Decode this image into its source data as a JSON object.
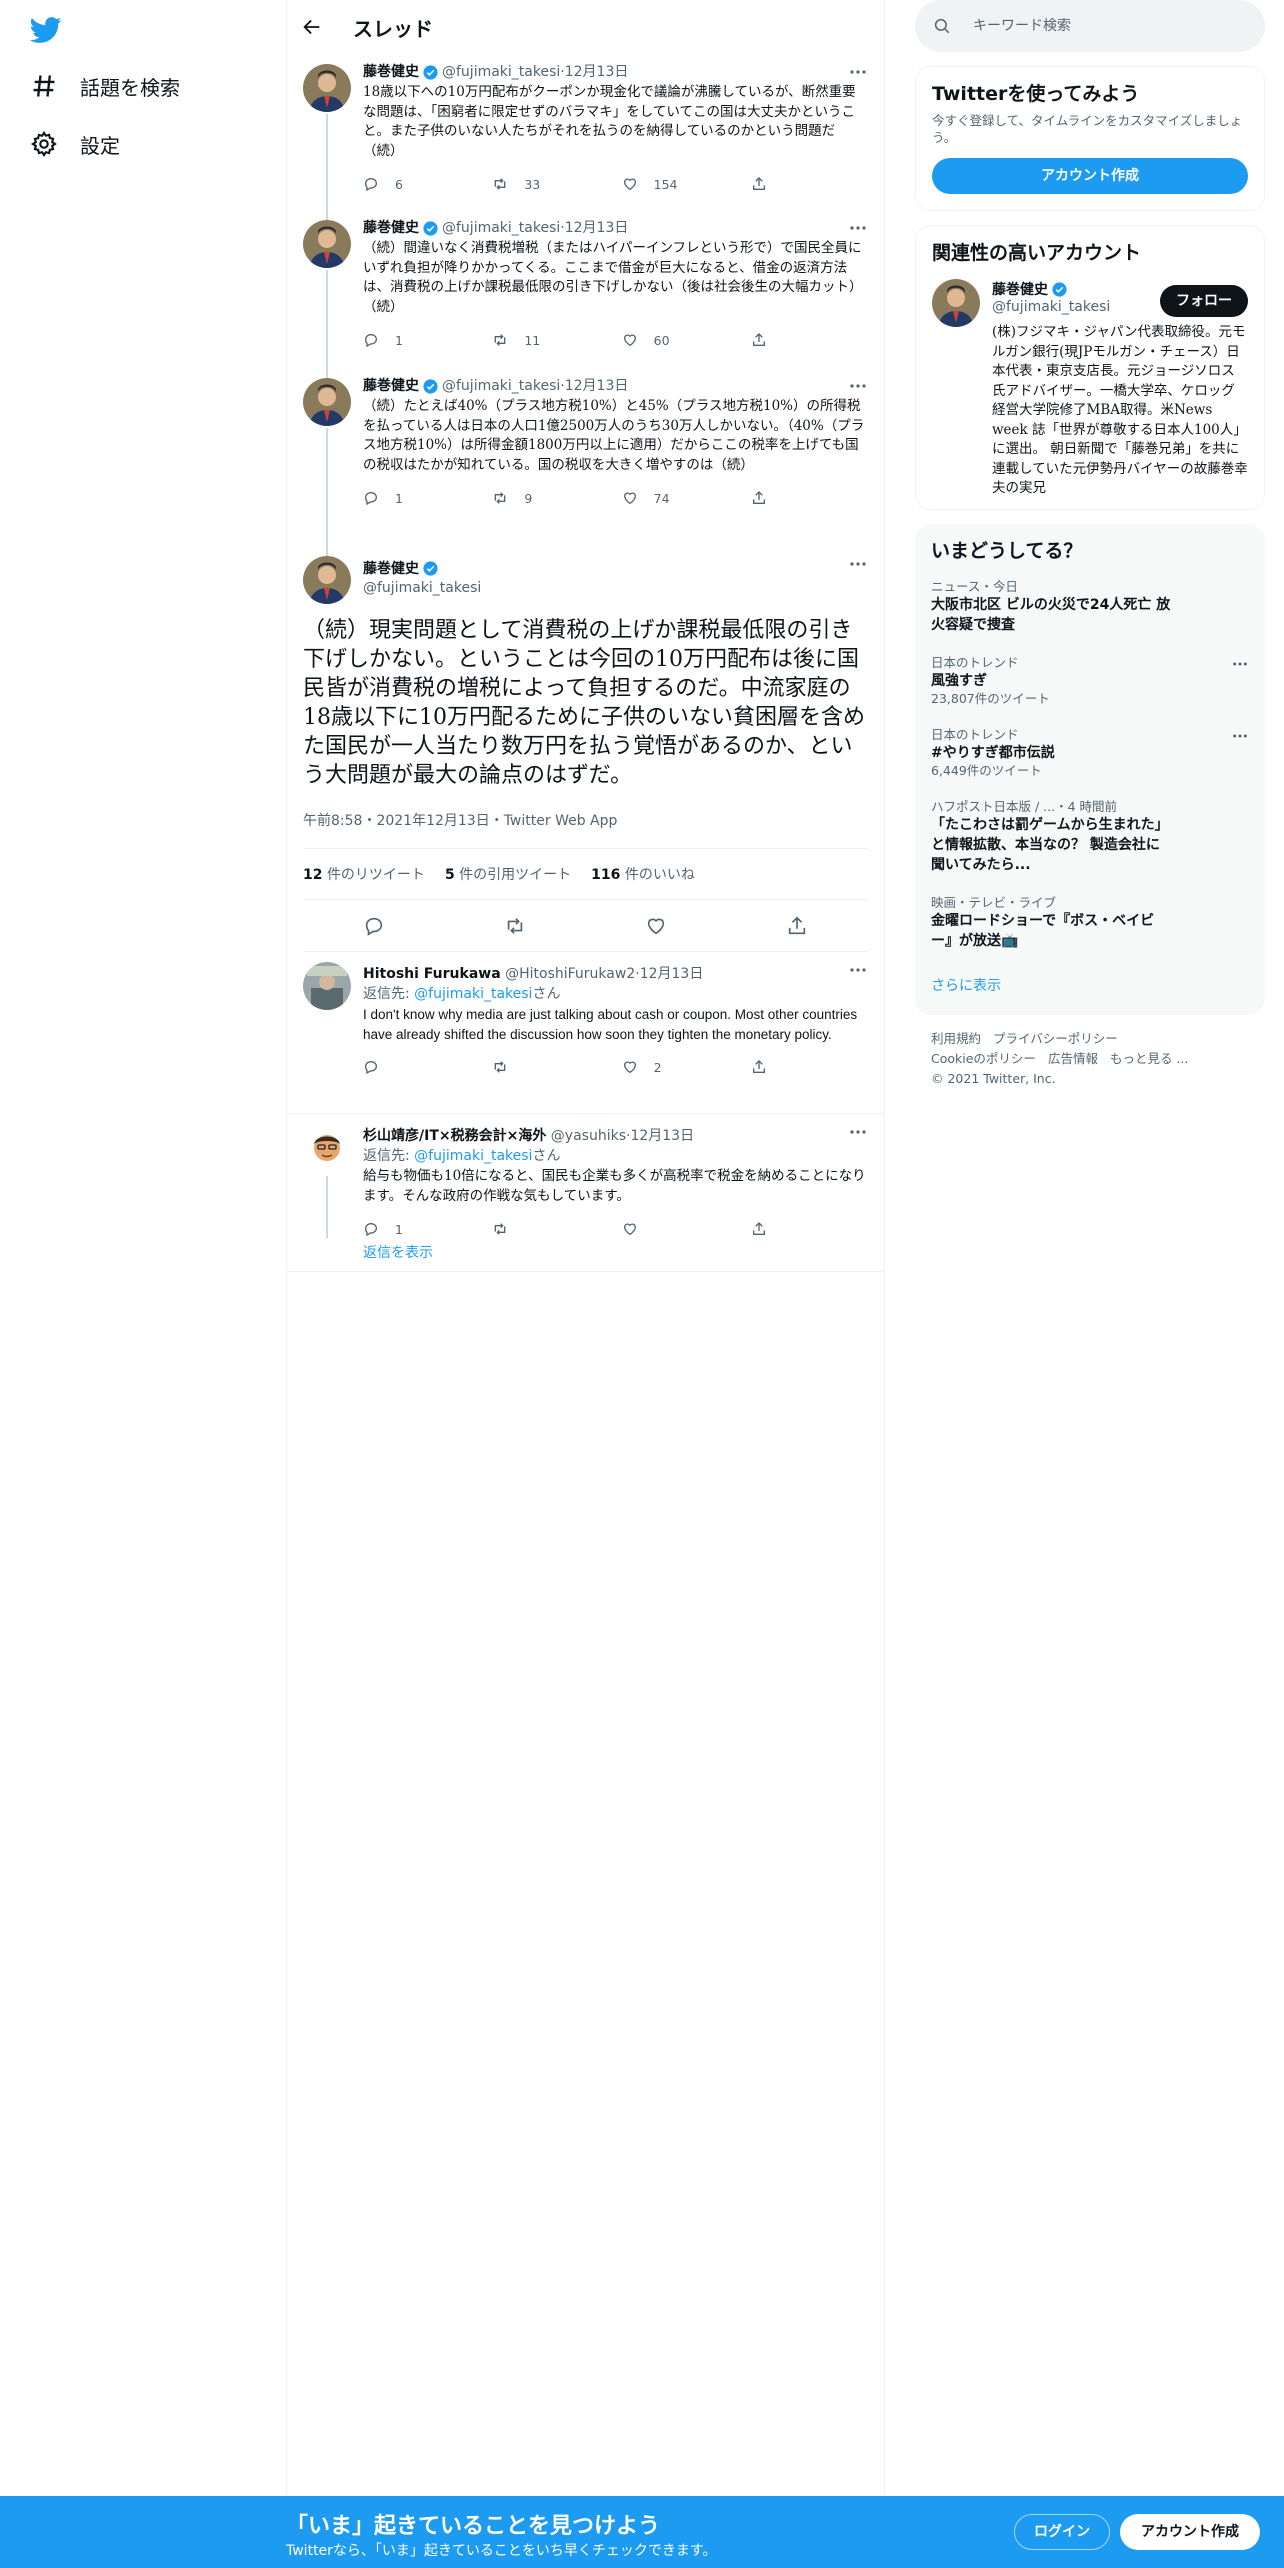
{
  "nav": {
    "explore_label": "話題を検索",
    "settings_label": "設定"
  },
  "header": {
    "title": "スレッド"
  },
  "thread": [
    {
      "name": "藤巻健史",
      "handle": "@fujimaki_takesi",
      "time": "12月13日",
      "text": "18歳以下への10万円配布がクーポンか現金化で議論が沸騰しているが、断然重要な問題は、「困窮者に限定せずのバラマキ」をしていてこの国は大丈夫かということ。また子供のいない人たちがそれを払うのを納得しているのかという問題だ（続）",
      "replies": "6",
      "retweets": "33",
      "likes": "154"
    },
    {
      "name": "藤巻健史",
      "handle": "@fujimaki_takesi",
      "time": "12月13日",
      "text": "（続）間違いなく消費税増税（またはハイパーインフレという形で）で国民全員にいずれ負担が降りかかってくる。ここまで借金が巨大になると、借金の返済方法は、消費税の上げか課税最低限の引き下げしかない（後は社会後生の大幅カット）（続）",
      "replies": "1",
      "retweets": "11",
      "likes": "60"
    },
    {
      "name": "藤巻健史",
      "handle": "@fujimaki_takesi",
      "time": "12月13日",
      "text": "（続）たとえば40%（プラス地方税10%）と45%（プラス地方税10%）の所得税を払っている人は日本の人口1億2500万人のうち30万人しかいない。（40%（プラス地方税10%）は所得金額1800万円以上に適用）だからここの税率を上げても国の税収はたかが知れている。国の税収を大きく増やすのは（続）",
      "replies": "1",
      "retweets": "9",
      "likes": "74"
    }
  ],
  "main_tweet": {
    "name": "藤巻健史",
    "handle": "@fujimaki_takesi",
    "text": "（続）現実問題として消費税の上げか課税最低限の引き下げしかない。ということは今回の10万円配布は後に国民皆が消費税の増税によって負担するのだ。中流家庭の18歳以下に10万円配るために子供のいない貧困層を含めた国民が一人当たり数万円を払う覚悟があるのか、という大問題が最大の論点のはずだ。",
    "meta": "午前8:58・2021年12月13日・Twitter Web App",
    "retweets_num": "12",
    "retweets_label": "件のリツイート",
    "quotes_num": "5",
    "quotes_label": "件の引用ツイート",
    "likes_num": "116",
    "likes_label": "件のいいね"
  },
  "replies": [
    {
      "name": "Hitoshi Furukawa",
      "handle": "@HitoshiFurukaw2",
      "time": "12月13日",
      "reply_prefix": "返信先: ",
      "reply_to": "@fujimaki_takesi",
      "reply_suffix": "さん",
      "text": "I don't know why media are just talking about cash or coupon. Most other countries have already shifted the discussion how soon they tighten the monetary policy.",
      "replies": "",
      "retweets": "",
      "likes": "2"
    },
    {
      "name": "杉山靖彦/IT×税務会計×海外",
      "handle": "@yasuhiks",
      "time": "12月13日",
      "reply_prefix": "返信先: ",
      "reply_to": "@fujimaki_takesi",
      "reply_suffix": "さん",
      "text": "給与も物価も10倍になると、国民も企業も多くが高税率で税金を納めることになります。そんな政府の作戦な気もしています。",
      "replies": "1",
      "retweets": "",
      "likes": ""
    }
  ],
  "show_replies_label": "返信を表示",
  "right": {
    "search_placeholder": "キーワード検索",
    "join_title": "Twitterを使ってみよう",
    "join_sub": "今すぐ登録して、タイムラインをカスタマイズしましょう。",
    "create_account": "アカウント作成",
    "relevant_title": "関連性の高いアカウント",
    "acct_name": "藤巻健史",
    "acct_handle": "@fujimaki_takesi",
    "follow_label": "フォロー",
    "acct_bio": "(株)フジマキ・ジャパン代表取締役。元モルガン銀行(現JPモルガン・チェース）日本代表・東京支店長。元ジョージソロス氏アドバイザー。一橋大学卒、ケロッグ経営大学院修了MBA取得。米News week 誌「世界が尊敬する日本人100人」に選出。 朝日新聞で「藤巻兄弟」を共に連載していた元伊勢丹バイヤーの故藤巻幸夫の実兄",
    "trends_title": "いまどうしてる？",
    "trends": [
      {
        "ctx": "ニュース・今日",
        "title": "大阪市北区 ビルの火災で24人死亡 放火容疑で捜査",
        "count": ""
      },
      {
        "ctx": "日本のトレンド",
        "title": "風強すぎ",
        "count": "23,807件のツイート"
      },
      {
        "ctx": "日本のトレンド",
        "title": "#やりすぎ都市伝説",
        "count": "6,449件のツイート"
      },
      {
        "ctx": "ハフポスト日本版 / ...・4 時間前",
        "title": "「たこわさは罰ゲームから生まれた」と情報拡散、本当なの？ 製造会社に聞いてみたら...",
        "count": ""
      },
      {
        "ctx": "映画・テレビ・ライブ",
        "title": "金曜ロードショーで『ボス・ベイビー』が放送📺",
        "count": ""
      }
    ],
    "show_more": "さらに表示",
    "footer": [
      "利用規約",
      "プライバシーポリシー",
      "Cookieのポリシー",
      "広告情報",
      "もっと見る ...",
      "© 2021 Twitter, Inc."
    ]
  },
  "bottom_bar": {
    "title": "「いま」起きていることを見つけよう",
    "subtitle": "Twitterなら、「いま」起きていることをいち早くチェックできます。",
    "login": "ログイン",
    "signup": "アカウント作成"
  },
  "colors": {
    "accent": "#1d9bf0",
    "text": "#0f1419",
    "muted": "#536471",
    "border": "#eff3f4"
  }
}
